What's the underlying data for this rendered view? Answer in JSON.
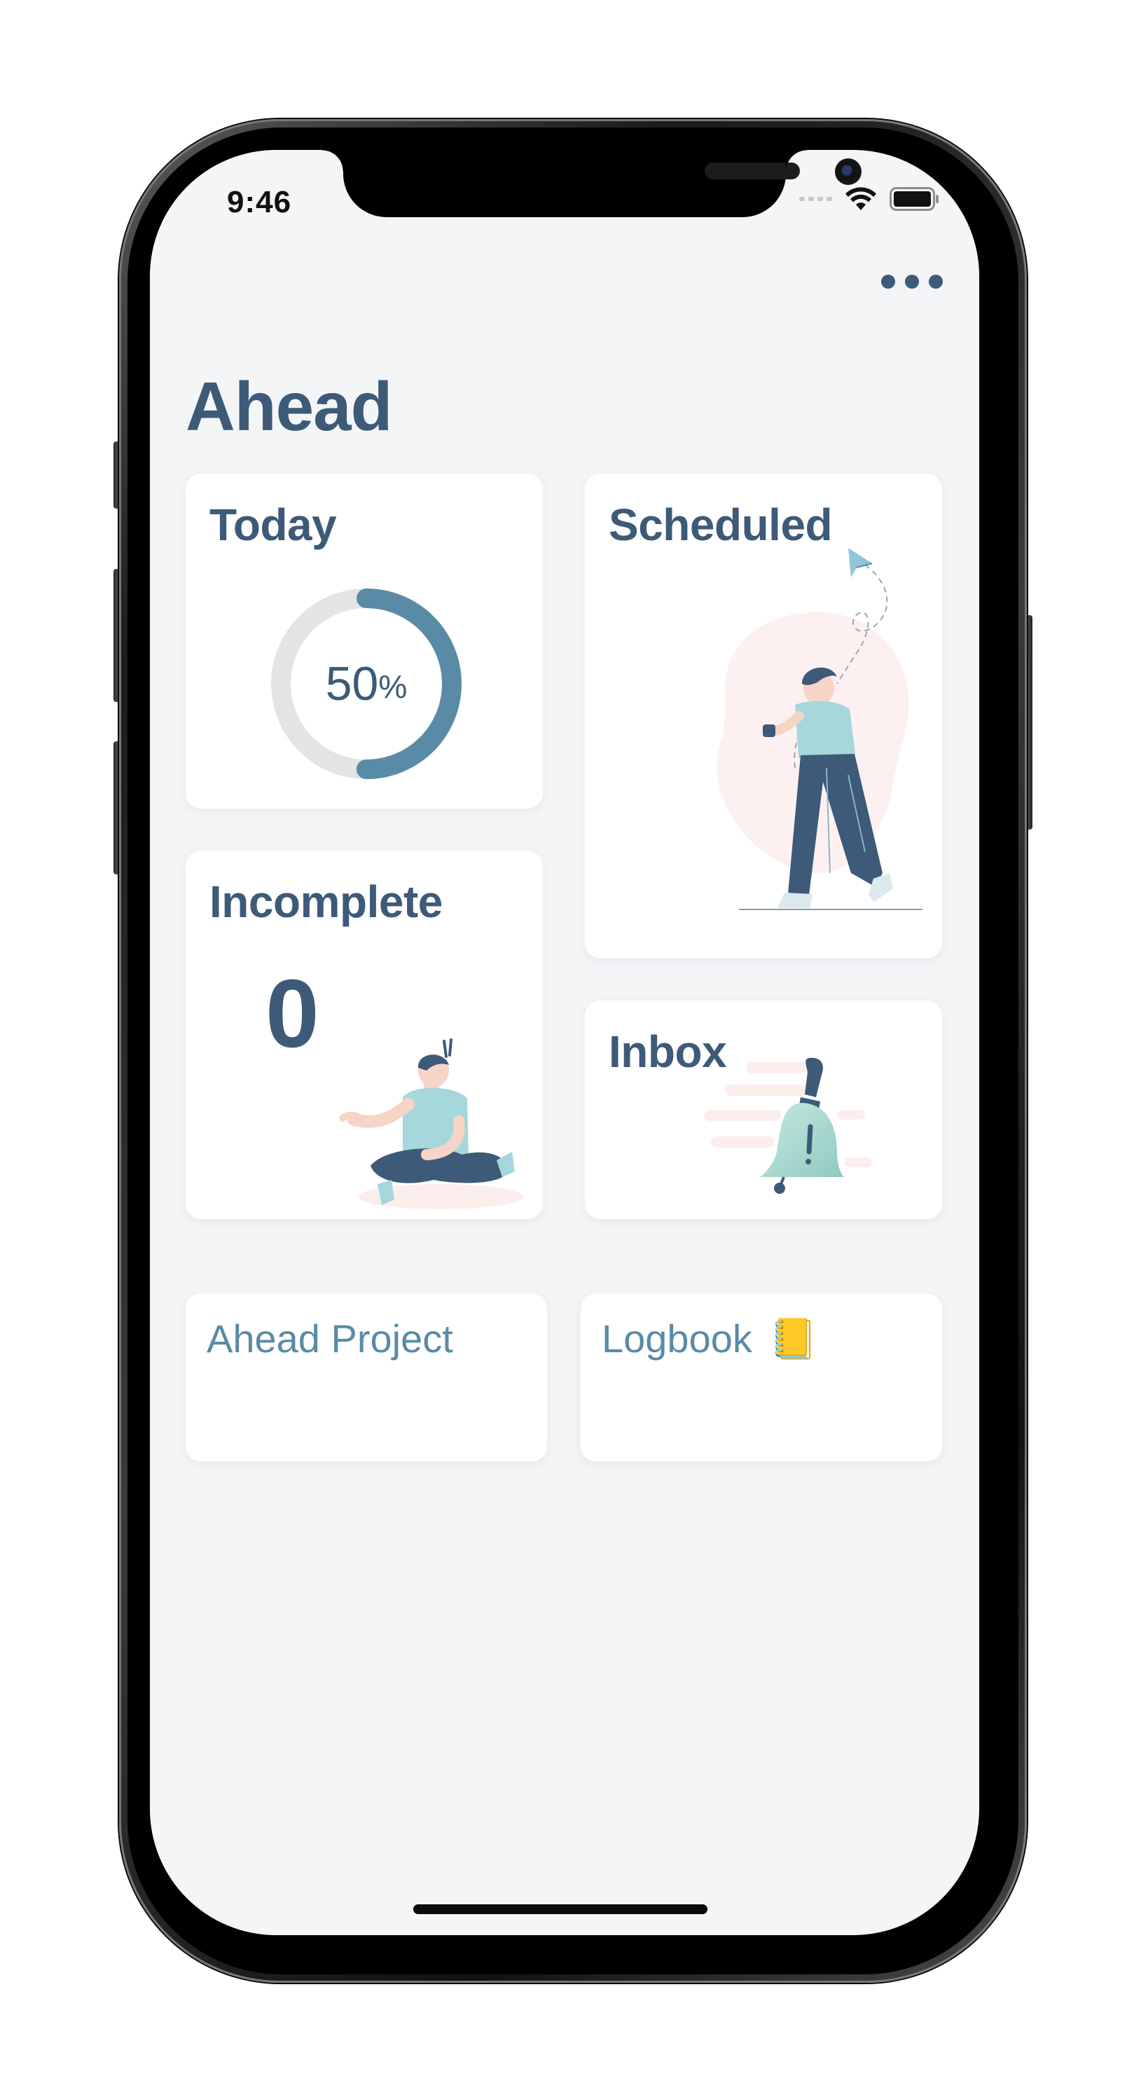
{
  "status_bar": {
    "time": "9:46",
    "icons": [
      "cellular-signal-icon",
      "wifi-icon",
      "battery-icon"
    ]
  },
  "header": {
    "more_icon": "more-horizontal-icon",
    "title": "Ahead"
  },
  "cards": {
    "today": {
      "title": "Today",
      "progress_value": "50",
      "progress_unit": "%",
      "progress_fraction": 0.5
    },
    "scheduled": {
      "title": "Scheduled",
      "illustration": "walking-person-paper-plane-illustration"
    },
    "incomplete": {
      "title": "Incomplete",
      "count": "0",
      "illustration": "sitting-person-illustration"
    },
    "inbox": {
      "title": "Inbox",
      "illustration": "bell-illustration"
    }
  },
  "lists": {
    "ahead_project": {
      "label": "Ahead Project"
    },
    "logbook": {
      "label": "Logbook",
      "emoji": "📒"
    }
  },
  "colors": {
    "primary": "#3d5a78",
    "accent": "#5a8ba6",
    "background": "#f4f5f7",
    "card": "#ffffff",
    "ring_track": "#e4e4e4"
  }
}
